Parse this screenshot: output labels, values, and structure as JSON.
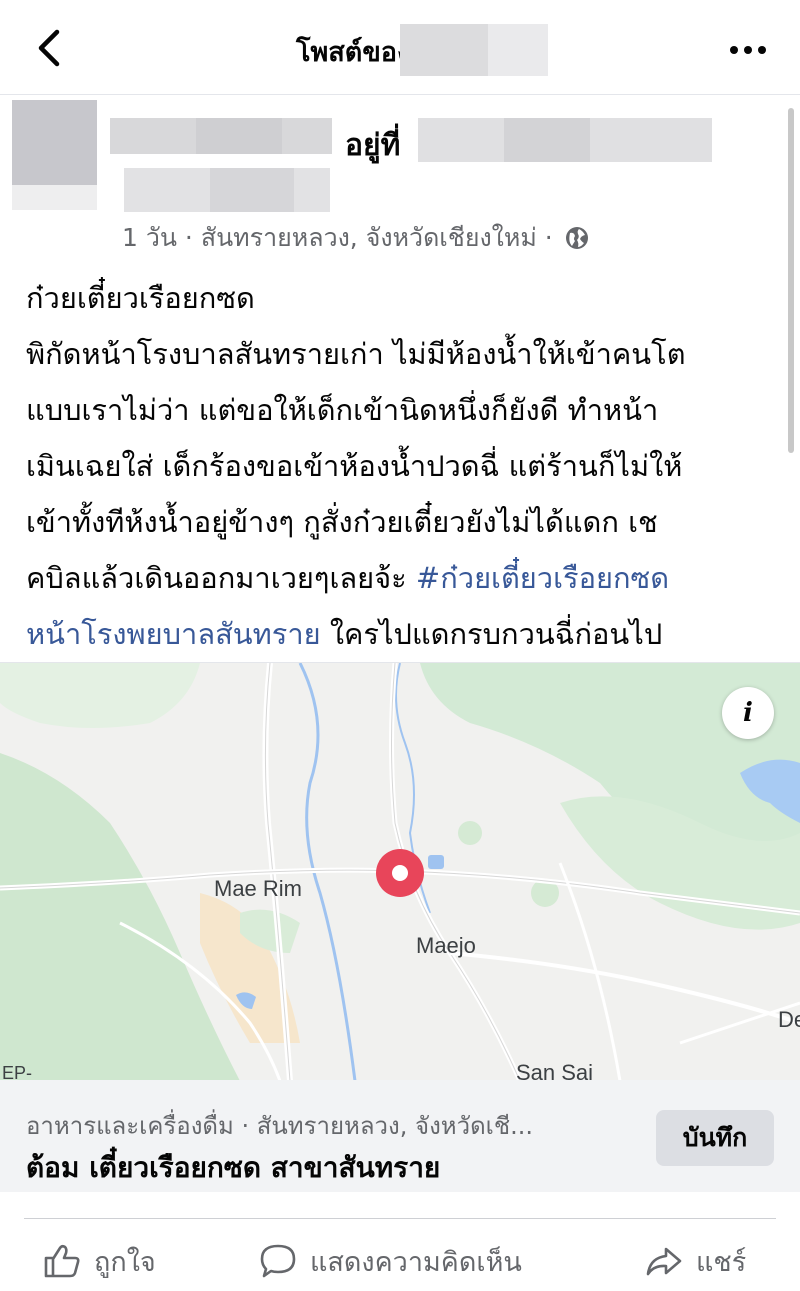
{
  "header": {
    "title": "โพสต์ของ",
    "back_icon": "chevron-left-icon",
    "more_icon": "more-dots-icon"
  },
  "post": {
    "location_prefix": "อยู่ที่",
    "meta": "1 วัน · สันทรายหลวง, จังหวัดเชียงใหม่ ·",
    "body_text": "ก๋วยเตี๋ยวเรือยกซด\nพิกัดหน้าโรงบาลสันทรายเก่า ไม่มีห้องน้ำให้เข้าคนโต\nแบบเราไม่ว่า แต่ขอให้เด็กเข้านิดหนึ่งก็ยังดี ทำหน้า\nเมินเฉยใส่ เด็กร้องขอเข้าห้องน้ำปวดฉี่ แต่ร้านก็ไม่ให้\nเข้าทั้งทีห้งน้ำอยู่ข้างๆ กูสั่งก๋วยเตี๋ยวยังไม่ได้แดก เช\nคบิลแล้วเดินออกมาเวยๆเลยจ้ะ ",
    "hashtag": "#ก๋วยเตี๋ยวเรือยกซด\nหน้าโรงพยบาลสันทราย",
    "body_text_after": " ใครไปแดกรบกวนฉี่ก่อนไป\nแดก  ใครรู้จักแท็กไปหน้าร้านมันกำเตอะ กูเนี้ย รีวิว",
    "hashtag_color": "#385898"
  },
  "map": {
    "labels": [
      "Mae Rim",
      "Maejo",
      "San Sai",
      "EP-",
      "De"
    ],
    "info_label": "i",
    "pin_color": "#e8455a"
  },
  "place": {
    "category": "อาหารและเครื่องดื่ม · สันทรายหลวง, จังหวัดเชี...",
    "name": "ต้อม เตี๋ยวเรือยกซด สาขาสันทราย",
    "save_label": "บันทึก"
  },
  "actions": {
    "like_label": "ถูกใจ",
    "comment_label": "แสดงความคิดเห็น",
    "share_label": "แชร์"
  }
}
